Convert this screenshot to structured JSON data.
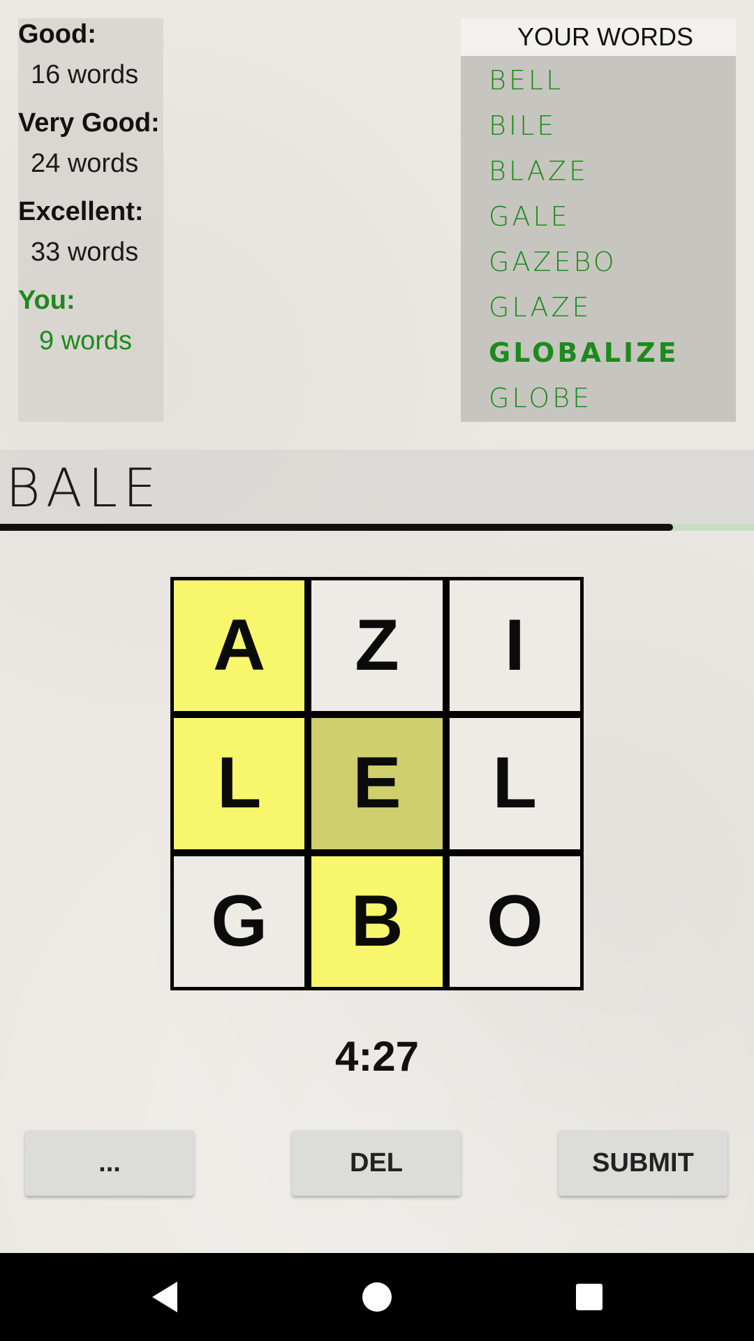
{
  "targets": {
    "good": {
      "label": "Good:",
      "value": "16 words"
    },
    "very_good": {
      "label": "Very Good:",
      "value": "24 words"
    },
    "excellent": {
      "label": "Excellent:",
      "value": "33 words"
    },
    "you": {
      "label": "You:",
      "value": "9 words"
    }
  },
  "your_words": {
    "header": "YOUR WORDS",
    "items": [
      "BELL",
      "BILE",
      "BLAZE",
      "GALE",
      "GAZEBO",
      "GLAZE",
      "GLOBALIZE",
      "GLOBE"
    ]
  },
  "current_word": "BALE",
  "timer_progress": 0.893,
  "grid": {
    "letters": [
      "A",
      "Z",
      "I",
      "L",
      "E",
      "L",
      "G",
      "B",
      "O"
    ]
  },
  "timer": "4:27",
  "buttons": {
    "more": "...",
    "delete": "DEL",
    "submit": "SUBMIT"
  },
  "colors": {
    "found_word": "#1c8a1c",
    "selected_cell": "#f8f76c",
    "current_cell": "#cfcf6d"
  },
  "icons": {
    "back": "back-triangle-icon",
    "home": "home-circle-icon",
    "recents": "recents-square-icon"
  }
}
